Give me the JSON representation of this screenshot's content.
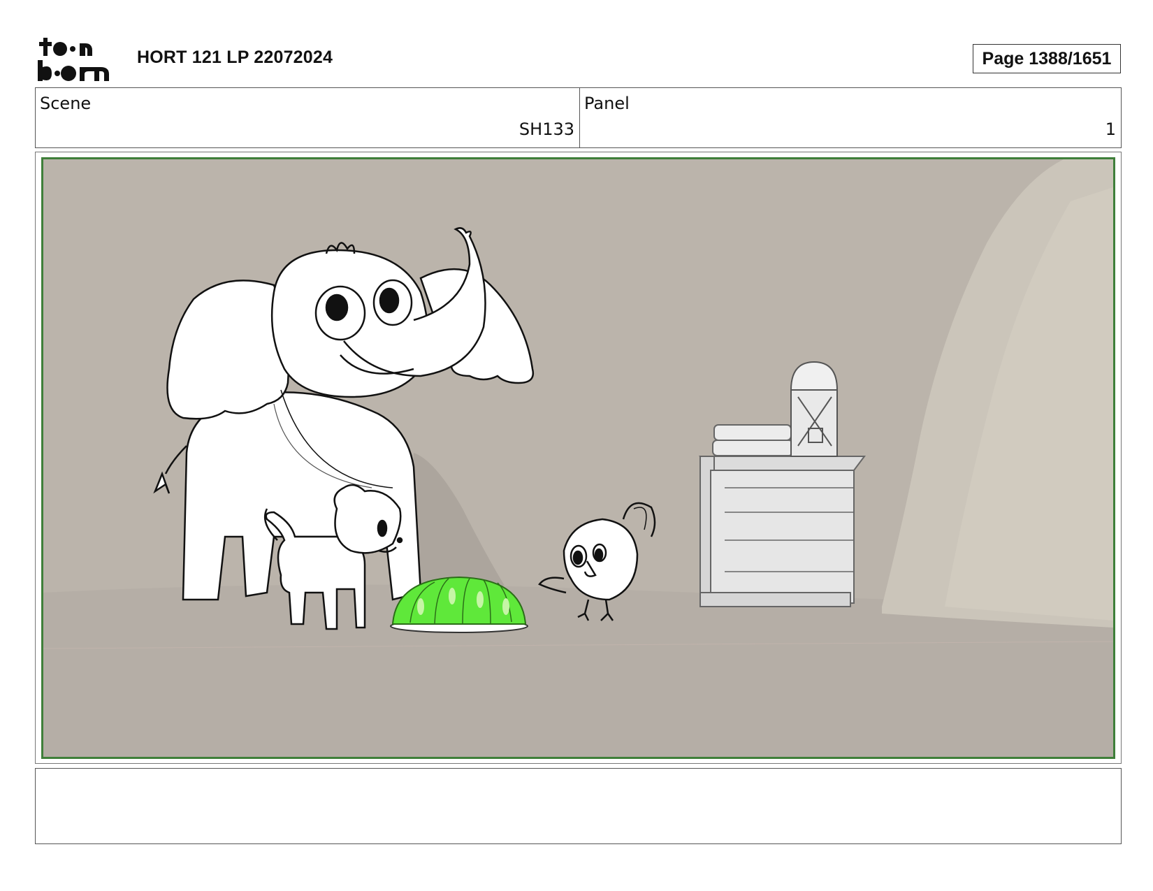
{
  "header": {
    "logo_text": "toon boom",
    "title": "HORT 121 LP 22072024",
    "page_label": "Page 1388/1651"
  },
  "info": {
    "scene_label": "Scene",
    "scene_value": "SH133",
    "panel_label": "Panel",
    "panel_value": "1"
  },
  "panel_image": {
    "description_icons": [
      "elephant-character",
      "cat-character",
      "bird-character",
      "green-jelly-dome",
      "wooden-crate",
      "lantern",
      "book-stack",
      "cave-rock"
    ],
    "colors": {
      "background": "#bab3ab",
      "frame_border": "#3f7f3a",
      "jelly": "#5fe83a"
    }
  },
  "notes": {
    "text": ""
  }
}
